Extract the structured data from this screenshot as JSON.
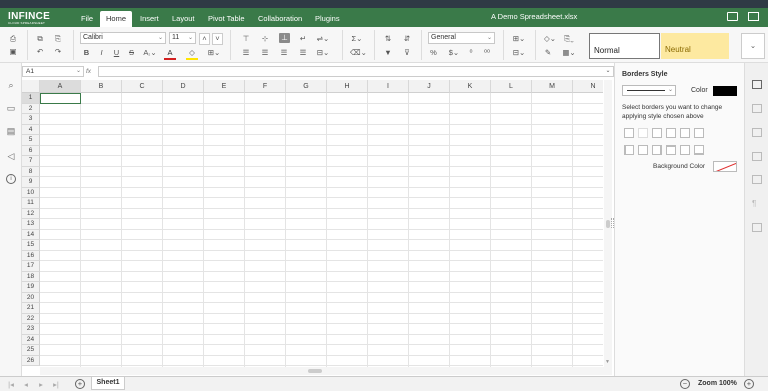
{
  "app": {
    "brand": "INFINCE",
    "brand_sub": "CLOUD SPREADSHEET",
    "document_title": "A Demo Spreadsheet.xlsx"
  },
  "menu": [
    {
      "label": "File"
    },
    {
      "label": "Home"
    },
    {
      "label": "Insert"
    },
    {
      "label": "Layout"
    },
    {
      "label": "Pivot Table"
    },
    {
      "label": "Collaboration"
    },
    {
      "label": "Plugins"
    }
  ],
  "toolbar": {
    "font_name": "Calibri",
    "font_size": "11",
    "number_format": "General",
    "style_normal": "Normal",
    "style_neutral": "Neutral",
    "bold": "B",
    "italic": "I",
    "underline": "U",
    "strike": "S",
    "font_color_glyph": "A",
    "sigma": "Σ",
    "percent": "%"
  },
  "formula_bar": {
    "cell_ref": "A1",
    "fx": "fx",
    "value": ""
  },
  "grid": {
    "columns": [
      "A",
      "B",
      "C",
      "D",
      "E",
      "F",
      "G",
      "H",
      "I",
      "J",
      "K",
      "L",
      "M",
      "N"
    ],
    "rows": [
      "1",
      "2",
      "3",
      "4",
      "5",
      "6",
      "7",
      "8",
      "9",
      "10",
      "11",
      "12",
      "13",
      "14",
      "15",
      "16",
      "17",
      "18",
      "19",
      "20",
      "21",
      "22",
      "23",
      "24",
      "25",
      "26"
    ],
    "selected_cell": "A1"
  },
  "borders_panel": {
    "title": "Borders Style",
    "color_label": "Color",
    "instructions": "Select borders you want to change applying style chosen above",
    "background_label": "Background Color",
    "border_color": "#000000"
  },
  "status": {
    "sheet_tab": "Sheet1",
    "zoom": "Zoom 100%"
  },
  "colors": {
    "brand_green": "#3a7a49",
    "neutral_fill": "#fde9a0",
    "topbar": "#2f3a45"
  }
}
